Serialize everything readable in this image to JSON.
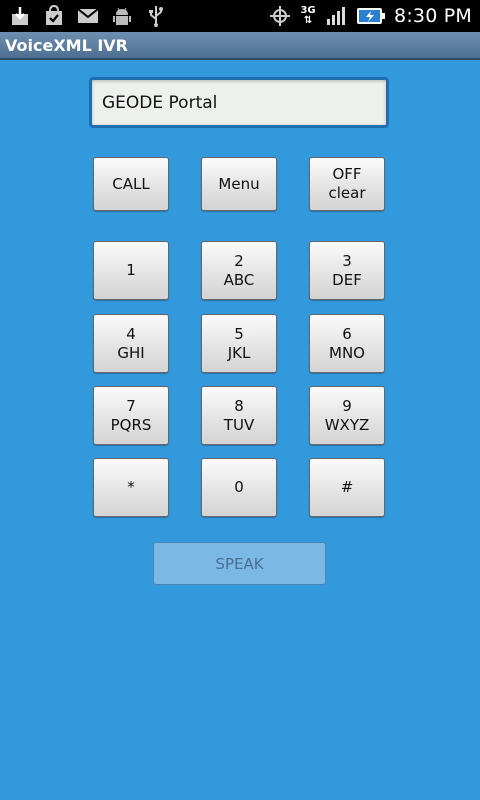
{
  "status_bar": {
    "time": "8:30 PM",
    "network_type_top": "3G",
    "network_type_bottom": "⇅",
    "left_icons": [
      "download-icon",
      "store-bag-icon",
      "gmail-icon",
      "android-debug-icon",
      "usb-icon"
    ],
    "right_icons": [
      "gps-icon",
      "network-3g-icon",
      "signal-bars-icon",
      "battery-charging-icon"
    ]
  },
  "title_bar": {
    "title": "VoiceXML IVR"
  },
  "input": {
    "value": "GEODE Portal"
  },
  "controls": {
    "call": "CALL",
    "menu": "Menu",
    "off_line1": "OFF",
    "off_line2": "clear"
  },
  "keypad": [
    {
      "digit": "1",
      "letters": ""
    },
    {
      "digit": "2",
      "letters": "ABC"
    },
    {
      "digit": "3",
      "letters": "DEF"
    },
    {
      "digit": "4",
      "letters": "GHI"
    },
    {
      "digit": "5",
      "letters": "JKL"
    },
    {
      "digit": "6",
      "letters": "MNO"
    },
    {
      "digit": "7",
      "letters": "PQRS"
    },
    {
      "digit": "8",
      "letters": "TUV"
    },
    {
      "digit": "9",
      "letters": "WXYZ"
    },
    {
      "digit": "*",
      "letters": ""
    },
    {
      "digit": "0",
      "letters": ""
    },
    {
      "digit": "#",
      "letters": ""
    }
  ],
  "speak_button": "SPEAK",
  "colors": {
    "background": "#3399dd",
    "title_bar": "#5a7ca0",
    "input_border": "#1f6fb0",
    "speak_button_bg": "#7bb8e4"
  }
}
